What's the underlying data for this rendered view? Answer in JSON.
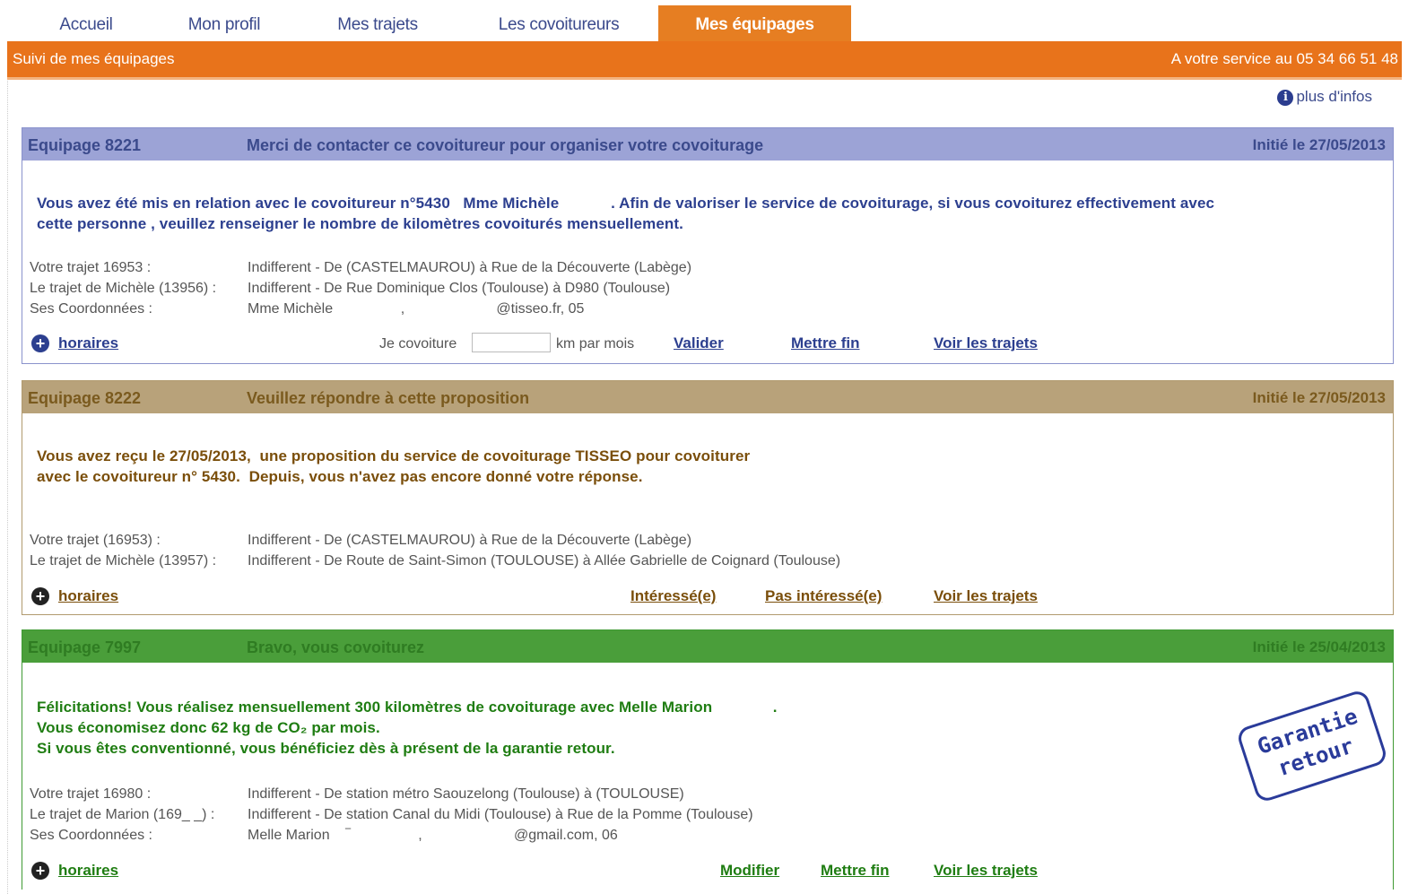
{
  "nav": {
    "tabs": [
      "Accueil",
      "Mon profil",
      "Mes trajets",
      "Les covoitureurs",
      "Mes équipages"
    ],
    "active_tab": "Mes équipages"
  },
  "banner": {
    "left": "Suivi de mes équipages",
    "right": "A votre service au 05 34 66 51 48"
  },
  "plus_infos": "plus d'infos",
  "equipages": [
    {
      "number": "Equipage 8221",
      "header_message": "Merci de contacter ce covoitureur pour organiser votre covoiturage",
      "date": "Initié le 27/05/2013",
      "intro_1": "Vous avez été mis en relation avec le covoitureur n°5430   Mme Michèle            . Afin de valoriser le service de covoiturage, si vous covoiturez effectivement avec",
      "intro_2": "cette personne , veuillez renseigner le nombre de kilomètres covoiturés mensuellement.",
      "rows": [
        {
          "label": "Votre trajet 16953 :",
          "value": "Indifferent - De (CASTELMAUROU) à Rue de la Découverte (Labège)"
        },
        {
          "label": "Le trajet de Michèle (13956) :",
          "value": "Indifferent - De Rue Dominique Clos (Toulouse) à D980 (Toulouse)"
        },
        {
          "label": "Ses Coordonnées :",
          "value": "Mme Michèle                 ,                       @tisseo.fr, 05"
        }
      ],
      "horaires": "horaires",
      "je_covoiture": "Je covoiture",
      "km_par_mois": "km par mois",
      "actions": [
        "Valider",
        "Mettre fin",
        "Voir les trajets"
      ]
    },
    {
      "number": "Equipage 8222",
      "header_message": "Veuillez répondre à cette proposition",
      "date": "Initié le 27/05/2013",
      "intro_1": "Vous avez reçu le 27/05/2013,  une proposition du service de covoiturage TISSEO pour covoiturer",
      "intro_2": "avec le covoitureur n° 5430.  Depuis, vous n'avez pas encore donné votre réponse.",
      "rows": [
        {
          "label": "Votre trajet (16953) :",
          "value": "Indifferent - De (CASTELMAUROU) à Rue de la Découverte (Labège)"
        },
        {
          "label": "Le trajet de Michèle (13957) :",
          "value": "Indifferent - De Route de Saint-Simon (TOULOUSE) à Allée Gabrielle de Coignard (Toulouse)"
        }
      ],
      "horaires": "horaires",
      "actions": [
        "Intéressé(e)",
        "Pas intéressé(e)",
        "Voir les trajets"
      ]
    },
    {
      "number": "Equipage 7997",
      "header_message": "Bravo, vous covoiturez",
      "date": "Initié le 25/04/2013",
      "intro_1": "Félicitations! Vous réalisez mensuellement 300 kilomètres de covoiturage avec Melle Marion              .",
      "intro_2": "Vous économisez donc 62 kg de CO₂ par mois.",
      "intro_3": "Si vous êtes conventionné, vous bénéficiez dès à présent de la garantie retour.",
      "rows": [
        {
          "label": "Votre trajet 16980 :",
          "value": "Indifferent - De station métro Saouzelong (Toulouse) à (TOULOUSE)"
        },
        {
          "label": "Le trajet de Marion (169_ _) :",
          "value": "Indifferent - De station Canal du Midi (Toulouse) à Rue de la Pomme (Toulouse)"
        },
        {
          "label": "Ses Coordonnées :",
          "value": "Melle Marion    ‾                 ,                       @gmail.com, 06"
        }
      ],
      "horaires": "horaires",
      "stamp_line1": "Garantie",
      "stamp_line2": "retour",
      "actions": [
        "Modifier",
        "Mettre fin",
        "Voir les trajets"
      ]
    }
  ],
  "colors": {
    "accent_orange": "#e8731b",
    "card1_header": "#9ca3d6",
    "card2_header": "#b8a27a",
    "card3_header": "#4a9e3a"
  }
}
